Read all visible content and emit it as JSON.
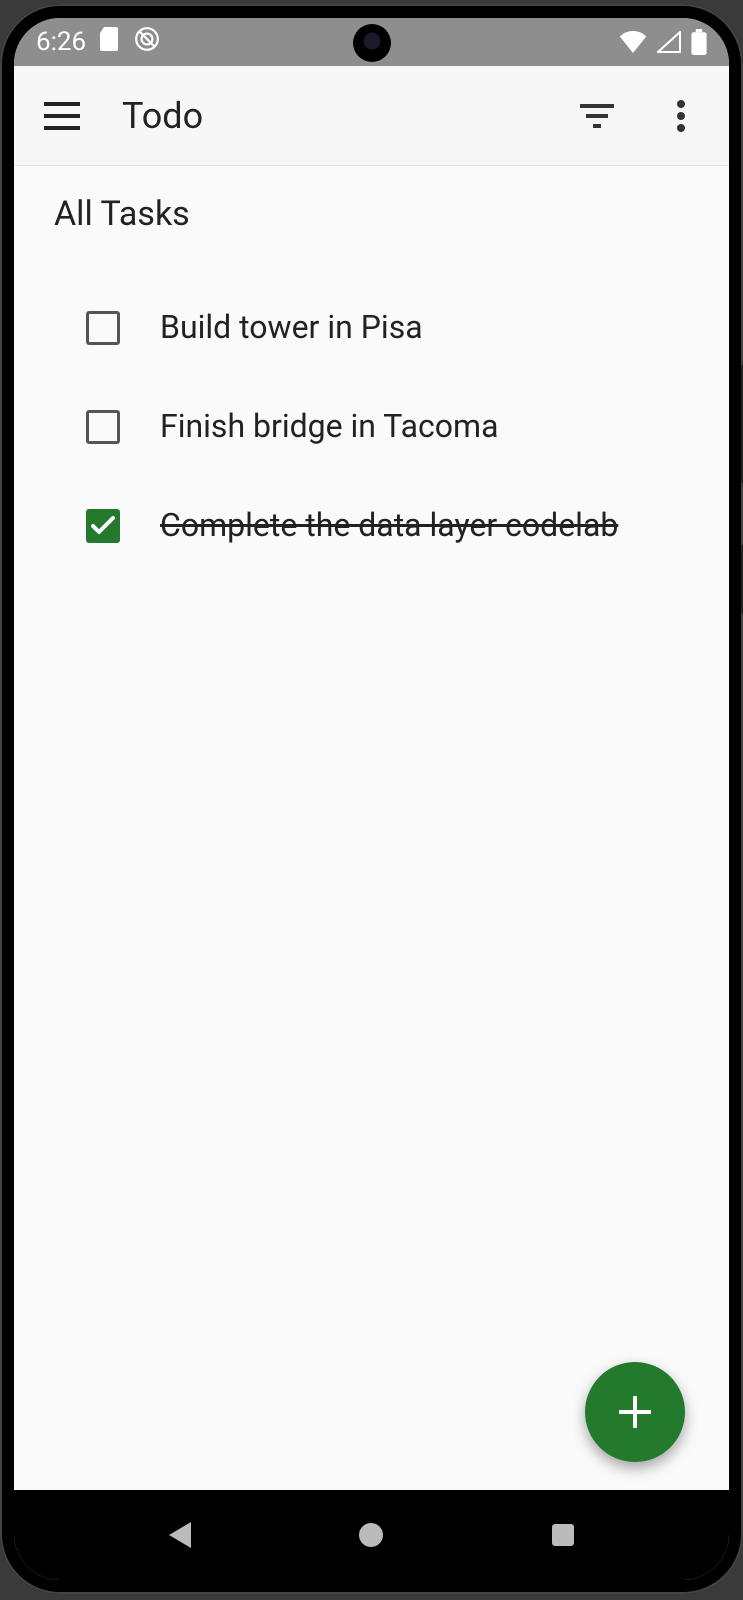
{
  "status": {
    "time": "6:26"
  },
  "appbar": {
    "title": "Todo"
  },
  "section": {
    "title": "All Tasks"
  },
  "tasks": [
    {
      "label": "Build tower in Pisa",
      "done": false
    },
    {
      "label": "Finish bridge in Tacoma",
      "done": false
    },
    {
      "label": "Complete the data layer codelab",
      "done": true
    }
  ],
  "colors": {
    "accent": "#247a2c"
  }
}
